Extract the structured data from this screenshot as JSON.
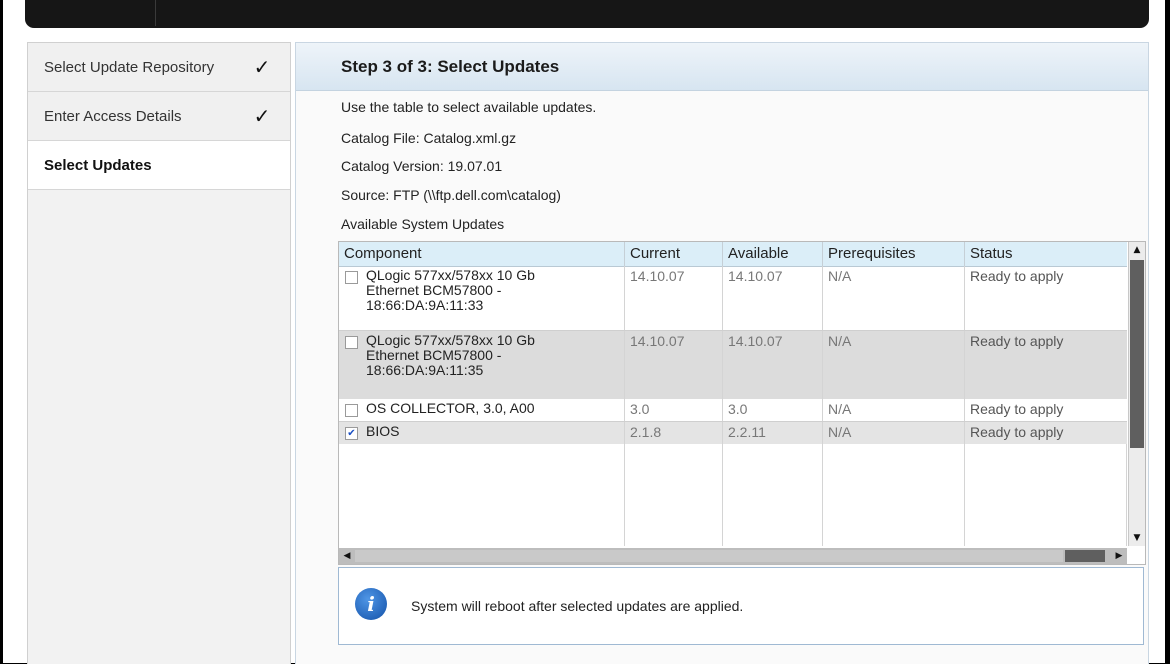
{
  "steps": [
    {
      "label": "Select Update Repository",
      "done": true
    },
    {
      "label": "Enter Access Details",
      "done": true
    },
    {
      "label": "Select Updates",
      "done": false
    }
  ],
  "check_glyph": "✓",
  "panel": {
    "title": "Step 3 of 3: Select Updates",
    "instruction": "Use the table to select available updates.",
    "catalog_file": "Catalog File: Catalog.xml.gz",
    "catalog_version": "Catalog Version: 19.07.01",
    "source": "Source: FTP (\\\\ftp.dell.com\\catalog)",
    "table_title": "Available System Updates"
  },
  "table": {
    "columns": [
      "Component",
      "Current",
      "Available",
      "Prerequisites",
      "Status"
    ],
    "rows": [
      {
        "component": "QLogic 577xx/578xx 10 Gb\nEthernet BCM57800 -\n18:66:DA:9A:11:33",
        "current": "14.10.07",
        "available": "14.10.07",
        "prerequisites": "N/A",
        "status": "Ready to apply",
        "checked": false
      },
      {
        "component": "QLogic 577xx/578xx 10 Gb\nEthernet BCM57800 -\n18:66:DA:9A:11:35",
        "current": "14.10.07",
        "available": "14.10.07",
        "prerequisites": "N/A",
        "status": "Ready to apply",
        "checked": false
      },
      {
        "component": "OS COLLECTOR, 3.0, A00",
        "current": "3.0",
        "available": "3.0",
        "prerequisites": "N/A",
        "status": "Ready to apply",
        "checked": false
      },
      {
        "component": "BIOS",
        "current": "2.1.8",
        "available": "2.2.11",
        "prerequisites": "N/A",
        "status": "Ready to apply",
        "checked": true
      }
    ]
  },
  "notice": {
    "icon": "i",
    "text": "System will reboot after selected updates are applied."
  },
  "colors": {
    "header_gradient": "#d7e5f1",
    "table_header": "#dbeef8",
    "info_icon": "#1351a8"
  }
}
